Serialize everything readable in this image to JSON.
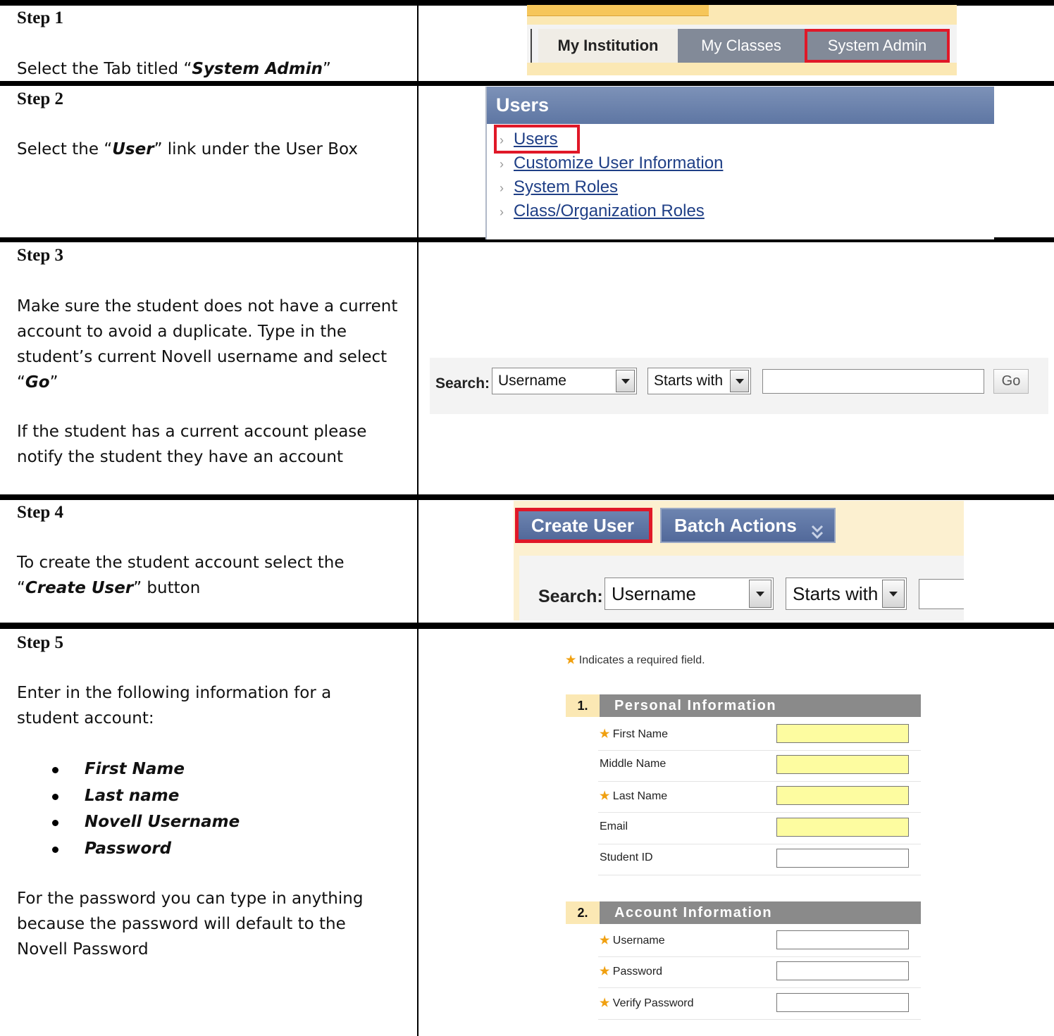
{
  "steps": [
    {
      "title": "Step 1",
      "text_before": "Select the Tab titled “",
      "emphasis": "System Admin",
      "text_after": "”"
    },
    {
      "title": "Step 2",
      "text_before": "Select the “",
      "emphasis": "User",
      "text_after": "” link under the User Box"
    },
    {
      "title": "Step 3",
      "text_before": "Make sure the student does not have a current account to avoid a duplicate.  Type in the student’s current Novell username and select “",
      "emphasis": "Go",
      "text_after": "”",
      "extra": "If the student has a current account please notify the student they have an account"
    },
    {
      "title": "Step 4",
      "text_before": "To create the student account select the “",
      "emphasis": "Create User",
      "text_after": "” button"
    },
    {
      "title": "Step 5",
      "text_before": "Enter in the following information for a student account:",
      "bullets": [
        "First Name",
        "Last name",
        "Novell Username",
        "Password"
      ],
      "extra": "For the password you can type in anything because the password will default to the Novell Password"
    }
  ],
  "step1_ui": {
    "tabs": [
      "My Institution",
      "My Classes",
      "System Admin"
    ]
  },
  "step2_ui": {
    "header": "Users",
    "links": [
      "Users",
      "Customize User Information",
      "System Roles",
      "Class/Organization Roles"
    ]
  },
  "search_ui": {
    "label": "Search:",
    "field_value": "Username",
    "operator_value": "Starts with",
    "search_value": "",
    "go_label": "Go"
  },
  "step4_ui": {
    "create_label": "Create User",
    "batch_label": "Batch Actions"
  },
  "step5_ui": {
    "required_note": "Indicates a required field.",
    "sections": [
      {
        "number": "1.",
        "title": "Personal Information",
        "fields": [
          {
            "label": "First Name",
            "required": true,
            "highlighted": true
          },
          {
            "label": "Middle Name",
            "required": false,
            "highlighted": true
          },
          {
            "label": "Last Name",
            "required": true,
            "highlighted": true
          },
          {
            "label": "Email",
            "required": false,
            "highlighted": true
          },
          {
            "label": "Student ID",
            "required": false,
            "highlighted": false
          }
        ]
      },
      {
        "number": "2.",
        "title": "Account Information",
        "fields": [
          {
            "label": "Username",
            "required": true,
            "highlighted": false
          },
          {
            "label": "Password",
            "required": true,
            "highlighted": false
          },
          {
            "label": "Verify Password",
            "required": true,
            "highlighted": false
          }
        ]
      }
    ]
  },
  "colors": {
    "highlight_red": "#e01828",
    "nav_blue": "#5e76a3",
    "tab_gray": "#828a98",
    "section_gray": "#8a8a8a",
    "required_star": "#f0a010",
    "field_yellow": "#fdfca0"
  }
}
